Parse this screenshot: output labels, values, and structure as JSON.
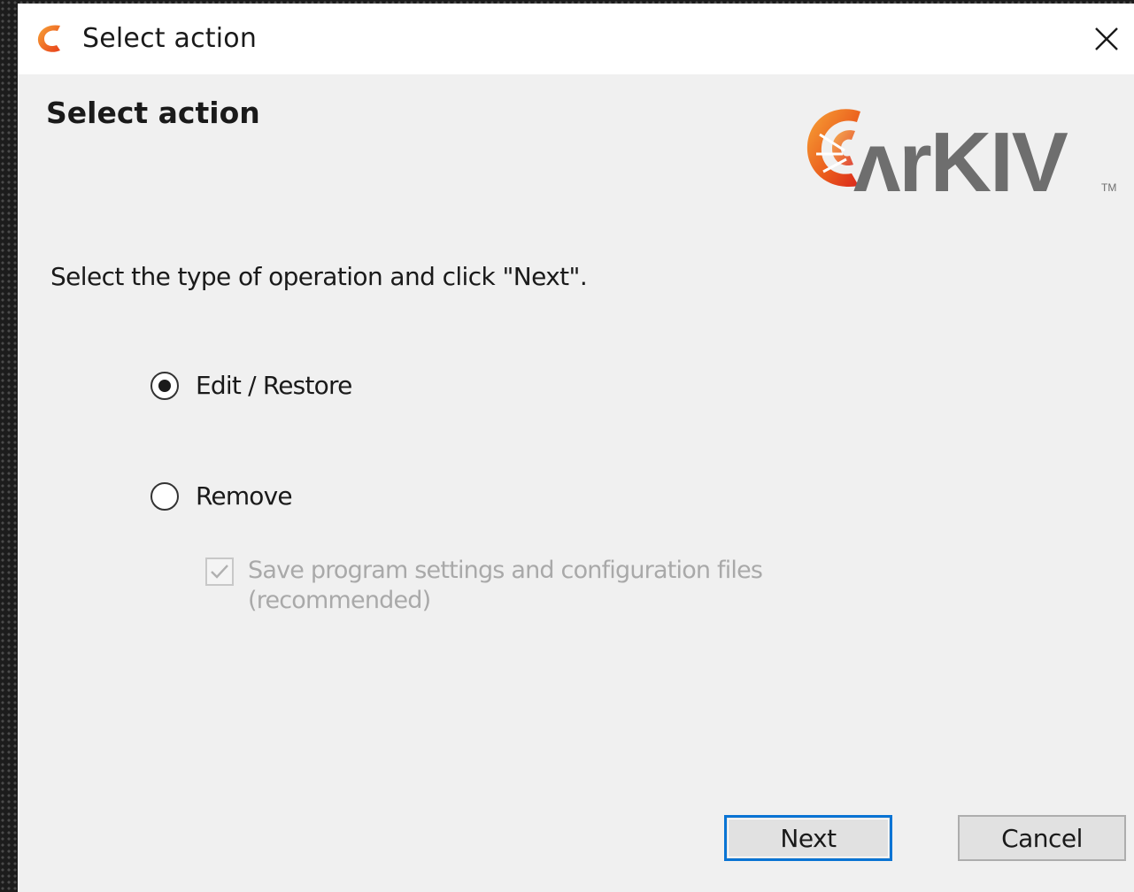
{
  "window": {
    "title": "Select action",
    "close_icon": "close-icon",
    "app_icon": "arkiv-app-icon"
  },
  "header": {
    "title": "Select action",
    "logo_text": "ARKIV",
    "logo_trademark": "TM"
  },
  "content": {
    "instruction": "Select the type of operation and click \"Next\".",
    "options": [
      {
        "label": "Edit / Restore",
        "selected": true
      },
      {
        "label": "Remove",
        "selected": false
      }
    ],
    "save_settings": {
      "line1": "Save program settings and configuration files",
      "line2": "(recommended)",
      "checked": true,
      "enabled": false
    }
  },
  "buttons": {
    "next": "Next",
    "cancel": "Cancel"
  },
  "colors": {
    "brand_orange": "#e8551b",
    "brand_gray": "#6e6e6e",
    "focus_blue": "#0a74d4"
  }
}
